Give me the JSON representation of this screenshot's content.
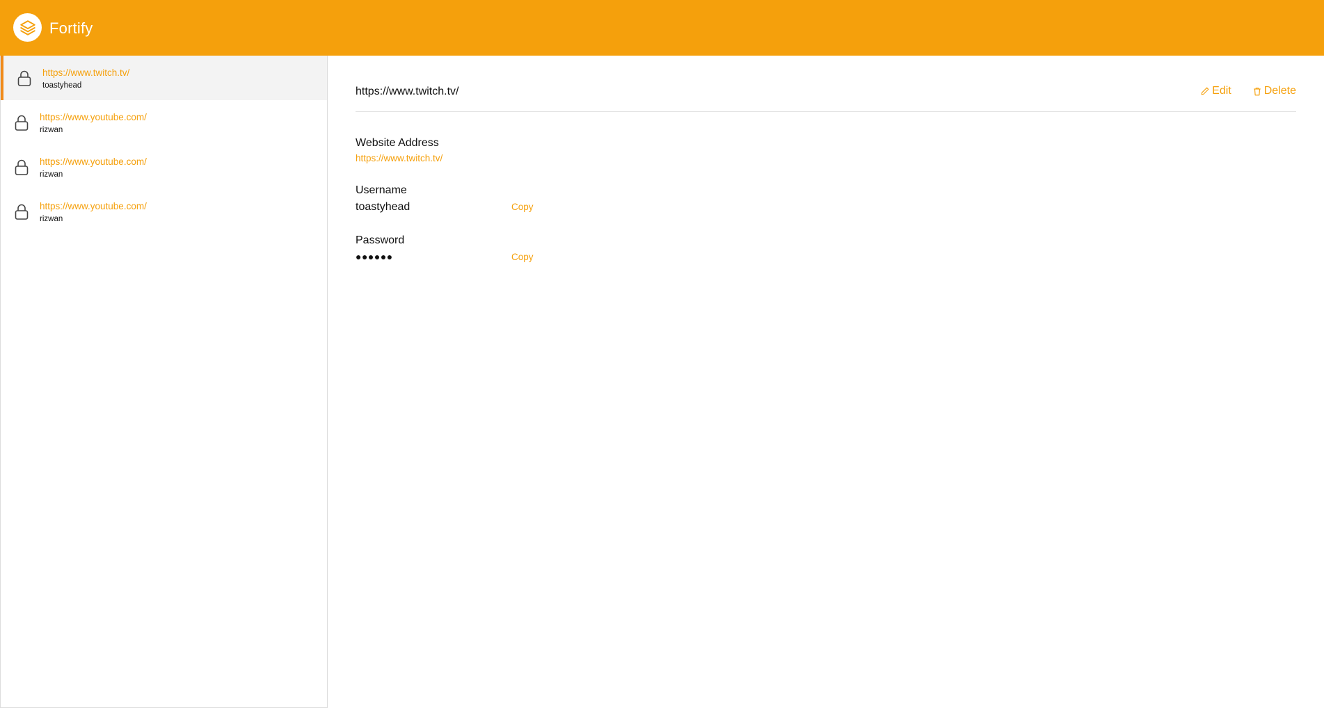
{
  "app": {
    "title": "Fortify",
    "brand_color": "#f5a00c",
    "accent_color": "#f08a1a"
  },
  "sidebar": {
    "items": [
      {
        "url": "https://www.twitch.tv/",
        "username": "toastyhead",
        "selected": true,
        "icon": "lock-icon"
      },
      {
        "url": "https://www.youtube.com/",
        "username": "rizwan",
        "selected": false,
        "icon": "lock-icon"
      },
      {
        "url": "https://www.youtube.com/",
        "username": "rizwan",
        "selected": false,
        "icon": "lock-icon"
      },
      {
        "url": "https://www.youtube.com/",
        "username": "rizwan",
        "selected": false,
        "icon": "lock-icon"
      }
    ]
  },
  "detail": {
    "title": "https://www.twitch.tv/",
    "edit_label": "Edit",
    "delete_label": "Delete",
    "website_label": "Website Address",
    "website_value": "https://www.twitch.tv/",
    "username_label": "Username",
    "username_value": "toastyhead",
    "password_label": "Password",
    "password_value": "●●●●●●",
    "copy_label": "Copy"
  }
}
